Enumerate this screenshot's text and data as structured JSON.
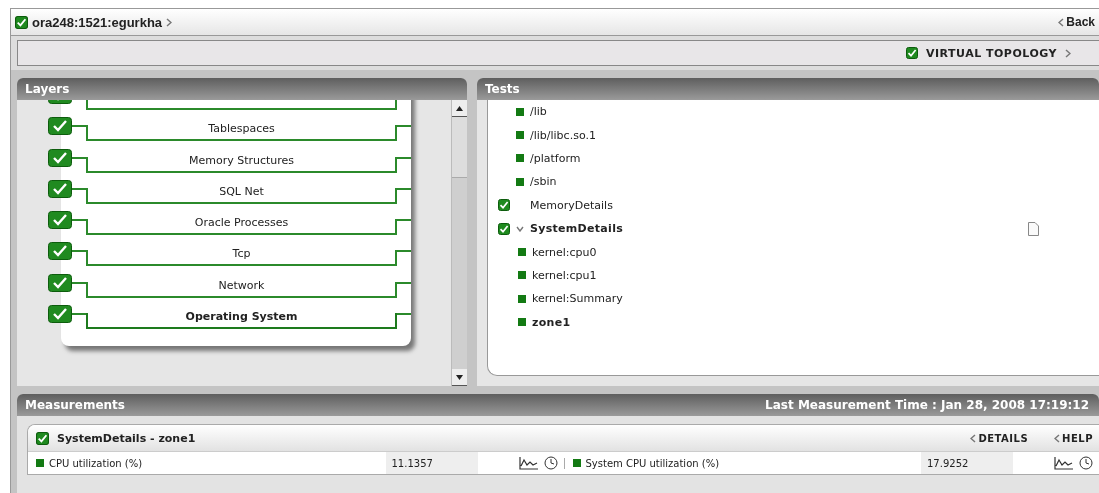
{
  "header": {
    "title": "ora248:1521:egurkha",
    "checked": true,
    "back_link": "Back"
  },
  "topology_link": {
    "label": "VIRTUAL TOPOLOGY",
    "checked": true
  },
  "layers_panel": {
    "title": "Layers",
    "items": [
      {
        "checked": true,
        "selected": false
      },
      {
        "label": "Tablespaces",
        "checked": true,
        "selected": false
      },
      {
        "label": "Memory Structures",
        "checked": true,
        "selected": false
      },
      {
        "label": "SQL Net",
        "checked": true,
        "selected": false
      },
      {
        "label": "Oracle Processes",
        "checked": true,
        "selected": false
      },
      {
        "label": "Tcp",
        "checked": true,
        "selected": false
      },
      {
        "label": "Network",
        "checked": true,
        "selected": false
      },
      {
        "label": "Operating System",
        "checked": true,
        "selected": true
      }
    ]
  },
  "tests_panel": {
    "title": "Tests",
    "items": [
      {
        "kind": "leaf",
        "label": "/lib",
        "selected": false
      },
      {
        "kind": "leaf",
        "label": "/lib/libc.so.1",
        "selected": false
      },
      {
        "kind": "leaf",
        "label": "/platform",
        "selected": false
      },
      {
        "kind": "leaf",
        "label": "/sbin",
        "selected": false
      },
      {
        "kind": "test",
        "label": "MemoryDetails",
        "checked": true,
        "expanded": false,
        "selected": false
      },
      {
        "kind": "test",
        "label": "SystemDetails",
        "checked": true,
        "expanded": true,
        "selected": true,
        "children": [
          {
            "kind": "leaf",
            "label": "kernel:cpu0",
            "selected": false
          },
          {
            "kind": "leaf",
            "label": "kernel:cpu1",
            "selected": false
          },
          {
            "kind": "leaf",
            "label": "kernel:Summary",
            "selected": false
          },
          {
            "kind": "leaf",
            "label": "zone1",
            "selected": true
          }
        ]
      }
    ]
  },
  "measurements": {
    "title": "Measurements",
    "last_time": "Last Measurement Time : Jan 28, 2008 17:19:12",
    "card": {
      "title": "SystemDetails - zone1",
      "checked": true,
      "links": [
        "DETAILS",
        "HELP"
      ],
      "rows": [
        {
          "name": "CPU utilization (%)",
          "value": "11.1357"
        },
        {
          "name": "System CPU utilization (%)",
          "value": "17.9252"
        }
      ]
    }
  }
}
